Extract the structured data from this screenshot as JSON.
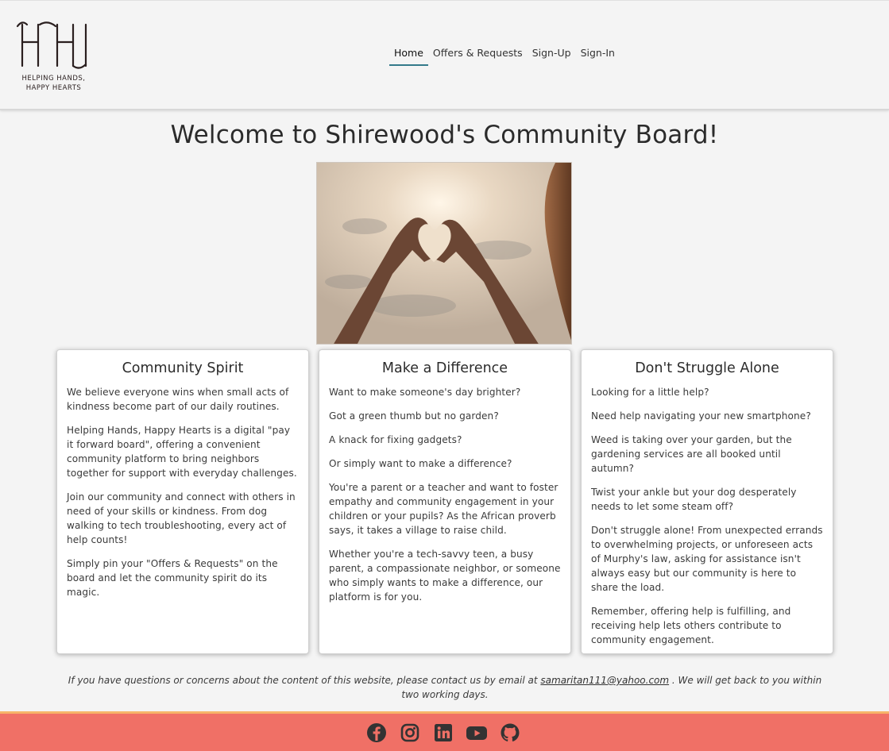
{
  "header": {
    "logo_line1": "HELPING HANDS,",
    "logo_line2": "HAPPY HEARTS",
    "nav": [
      {
        "label": "Home",
        "active": true
      },
      {
        "label": "Offers & Requests",
        "active": false
      },
      {
        "label": "Sign-Up",
        "active": false
      },
      {
        "label": "Sign-In",
        "active": false
      }
    ]
  },
  "main": {
    "title": "Welcome to Shirewood's Community Board!",
    "hero_image": "hands-heart-photo",
    "cards": [
      {
        "title": "Community Spirit",
        "paragraphs": [
          "We believe everyone wins when small acts of kindness become part of our daily routines.",
          "Helping Hands, Happy Hearts is a digital \"pay it forward board\", offering a convenient community platform to bring neighbors together for support with everyday challenges.",
          "Join our community and connect with others in need of your skills or kindness. From dog walking to tech troubleshooting, every act of help counts!",
          "Simply pin your \"Offers & Requests\" on the board and let the community spirit do its magic."
        ]
      },
      {
        "title": "Make a Difference",
        "paragraphs": [
          "Want to make someone's day brighter?",
          "Got a green thumb but no garden?",
          "A knack for fixing gadgets?",
          "Or simply want to make a difference?",
          "You're a parent or a teacher and want to foster empathy and community engagement in your children or your pupils? As the African proverb says, it takes a village to raise child.",
          "Whether you're a tech-savvy teen, a busy parent, a compassionate neighbor, or someone who simply wants to make a difference, our platform is for you."
        ]
      },
      {
        "title": "Don't Struggle Alone",
        "paragraphs": [
          "Looking for a little help?",
          "Need help navigating your new smartphone?",
          "Weed is taking over your garden, but the gardening services are all booked until autumn?",
          "Twist your ankle but your dog desperately needs to let some steam off?",
          "Don't struggle alone! From unexpected errands to overwhelming projects, or unforeseen acts of Murphy's law, asking for assistance isn't always easy but our community is here to share the load.",
          "Remember, offering help is fulfilling, and receiving help lets others contribute to community engagement."
        ]
      }
    ],
    "contact_before": "If you have questions or concerns about the content of this website, please contact us by email at",
    "contact_email": "samaritan111@yahoo.com",
    "contact_after": ". We will get back to you within two working days."
  },
  "footer": {
    "social_icons": [
      "facebook-icon",
      "instagram-icon",
      "linkedin-icon",
      "youtube-icon",
      "github-icon"
    ]
  },
  "colors": {
    "footer_bg": "#f07066",
    "footer_border": "#f7b469",
    "nav_active_underline": "#337a8a",
    "page_bg": "#f4f4f4"
  }
}
